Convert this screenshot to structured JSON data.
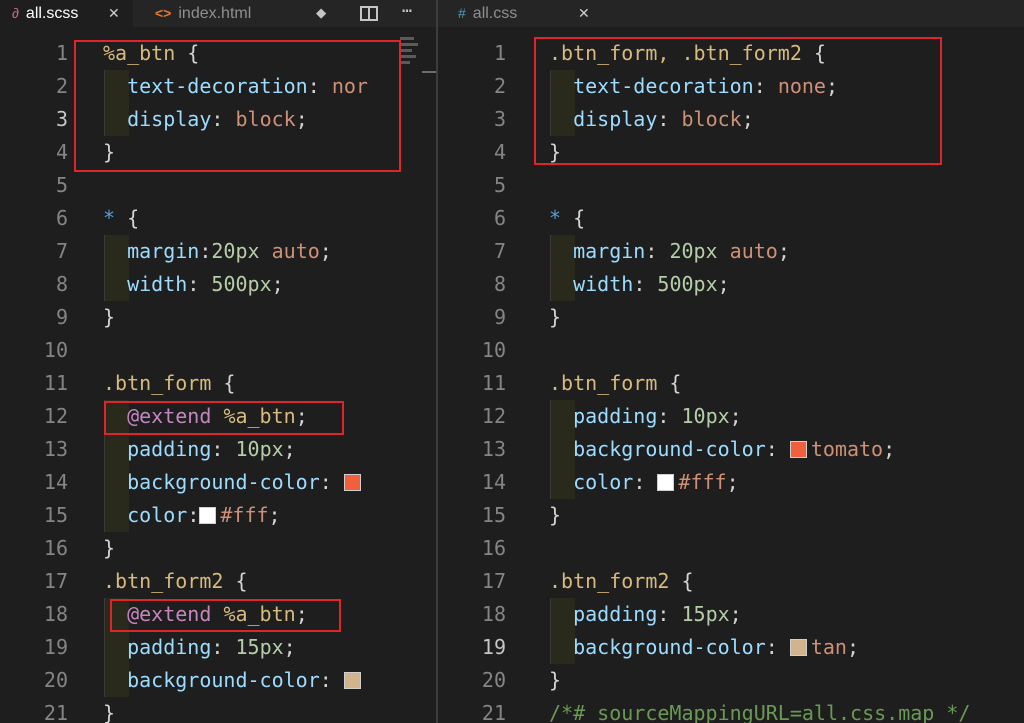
{
  "left": {
    "tabs": [
      {
        "name": "all.scss",
        "icon": "sass-file-icon",
        "active": true
      },
      {
        "name": "index.html",
        "icon": "html-file-icon",
        "active": false
      }
    ],
    "toolbar": {
      "git_icon": "git-compare-icon",
      "split_icon": "split-editor-icon",
      "more_icon": "more-actions-icon"
    },
    "lines": [
      {
        "n": "1",
        "tokens": [
          [
            "%a_btn",
            "sel"
          ],
          [
            " {",
            "p"
          ]
        ]
      },
      {
        "n": "2",
        "tokens": [
          [
            "  ",
            "p"
          ],
          [
            "text-decoration",
            "prop"
          ],
          [
            ": ",
            "p"
          ],
          [
            "nor",
            "val"
          ]
        ]
      },
      {
        "n": "3",
        "tokens": [
          [
            "  ",
            "p"
          ],
          [
            "display",
            "prop"
          ],
          [
            ": ",
            "p"
          ],
          [
            "block",
            "val"
          ],
          [
            ";",
            "p"
          ]
        ]
      },
      {
        "n": "4",
        "tokens": [
          [
            "}",
            "p"
          ]
        ]
      },
      {
        "n": "5",
        "tokens": []
      },
      {
        "n": "6",
        "tokens": [
          [
            "*",
            "star"
          ],
          [
            " {",
            "p"
          ]
        ]
      },
      {
        "n": "7",
        "tokens": [
          [
            "  ",
            "p"
          ],
          [
            "margin",
            "prop"
          ],
          [
            ":",
            "p"
          ],
          [
            "20px",
            "num"
          ],
          [
            " ",
            "p"
          ],
          [
            "auto",
            "val"
          ],
          [
            ";",
            "p"
          ]
        ]
      },
      {
        "n": "8",
        "tokens": [
          [
            "  ",
            "p"
          ],
          [
            "width",
            "prop"
          ],
          [
            ": ",
            "p"
          ],
          [
            "500px",
            "num"
          ],
          [
            ";",
            "p"
          ]
        ]
      },
      {
        "n": "9",
        "tokens": [
          [
            "}",
            "p"
          ]
        ]
      },
      {
        "n": "10",
        "tokens": []
      },
      {
        "n": "11",
        "tokens": [
          [
            ".btn_form",
            "sel"
          ],
          [
            " {",
            "p"
          ]
        ]
      },
      {
        "n": "12",
        "tokens": [
          [
            "  ",
            "p"
          ],
          [
            "@extend",
            "kw"
          ],
          [
            " ",
            "p"
          ],
          [
            "%a_btn",
            "sel"
          ],
          [
            ";",
            "p"
          ]
        ]
      },
      {
        "n": "13",
        "tokens": [
          [
            "  ",
            "p"
          ],
          [
            "padding",
            "prop"
          ],
          [
            ": ",
            "p"
          ],
          [
            "10px",
            "num"
          ],
          [
            ";",
            "p"
          ]
        ]
      },
      {
        "n": "14",
        "tokens": [
          [
            "  ",
            "p"
          ],
          [
            "background-color",
            "prop"
          ],
          [
            ": ",
            "p"
          ],
          [
            "swatch:#f0603c",
            "sw"
          ]
        ]
      },
      {
        "n": "15",
        "tokens": [
          [
            "  ",
            "p"
          ],
          [
            "color",
            "prop"
          ],
          [
            ":",
            "p"
          ],
          [
            "swatch:#ffffff",
            "sw"
          ],
          [
            "#fff",
            "val"
          ],
          [
            ";",
            "p"
          ]
        ]
      },
      {
        "n": "16",
        "tokens": [
          [
            "}",
            "p"
          ]
        ]
      },
      {
        "n": "17",
        "tokens": [
          [
            ".btn_form2",
            "sel"
          ],
          [
            " {",
            "p"
          ]
        ]
      },
      {
        "n": "18",
        "tokens": [
          [
            "  ",
            "p"
          ],
          [
            "@extend",
            "kw"
          ],
          [
            " ",
            "p"
          ],
          [
            "%a_btn",
            "sel"
          ],
          [
            ";",
            "p"
          ]
        ]
      },
      {
        "n": "19",
        "tokens": [
          [
            "  ",
            "p"
          ],
          [
            "padding",
            "prop"
          ],
          [
            ": ",
            "p"
          ],
          [
            "15px",
            "num"
          ],
          [
            ";",
            "p"
          ]
        ]
      },
      {
        "n": "20",
        "tokens": [
          [
            "  ",
            "p"
          ],
          [
            "background-color",
            "prop"
          ],
          [
            ": ",
            "p"
          ],
          [
            "swatch:#d2b48c",
            "sw"
          ]
        ]
      },
      {
        "n": "21",
        "tokens": [
          [
            "}",
            "p"
          ]
        ]
      }
    ],
    "current_line": "3"
  },
  "right": {
    "tabs": [
      {
        "name": "all.css",
        "icon": "css-file-icon",
        "active": false
      }
    ],
    "lines": [
      {
        "n": "1",
        "tokens": [
          [
            ".btn_form, .btn_form2",
            "sel"
          ],
          [
            " {",
            "p"
          ]
        ]
      },
      {
        "n": "2",
        "tokens": [
          [
            "  ",
            "p"
          ],
          [
            "text-decoration",
            "prop"
          ],
          [
            ": ",
            "p"
          ],
          [
            "none",
            "val"
          ],
          [
            ";",
            "p"
          ]
        ]
      },
      {
        "n": "3",
        "tokens": [
          [
            "  ",
            "p"
          ],
          [
            "display",
            "prop"
          ],
          [
            ": ",
            "p"
          ],
          [
            "block",
            "val"
          ],
          [
            ";",
            "p"
          ]
        ]
      },
      {
        "n": "4",
        "tokens": [
          [
            "}",
            "p"
          ]
        ]
      },
      {
        "n": "5",
        "tokens": []
      },
      {
        "n": "6",
        "tokens": [
          [
            "*",
            "star"
          ],
          [
            " {",
            "p"
          ]
        ]
      },
      {
        "n": "7",
        "tokens": [
          [
            "  ",
            "p"
          ],
          [
            "margin",
            "prop"
          ],
          [
            ": ",
            "p"
          ],
          [
            "20px",
            "num"
          ],
          [
            " ",
            "p"
          ],
          [
            "auto",
            "val"
          ],
          [
            ";",
            "p"
          ]
        ]
      },
      {
        "n": "8",
        "tokens": [
          [
            "  ",
            "p"
          ],
          [
            "width",
            "prop"
          ],
          [
            ": ",
            "p"
          ],
          [
            "500px",
            "num"
          ],
          [
            ";",
            "p"
          ]
        ]
      },
      {
        "n": "9",
        "tokens": [
          [
            "}",
            "p"
          ]
        ]
      },
      {
        "n": "10",
        "tokens": []
      },
      {
        "n": "11",
        "tokens": [
          [
            ".btn_form",
            "sel"
          ],
          [
            " {",
            "p"
          ]
        ]
      },
      {
        "n": "12",
        "tokens": [
          [
            "  ",
            "p"
          ],
          [
            "padding",
            "prop"
          ],
          [
            ": ",
            "p"
          ],
          [
            "10px",
            "num"
          ],
          [
            ";",
            "p"
          ]
        ]
      },
      {
        "n": "13",
        "tokens": [
          [
            "  ",
            "p"
          ],
          [
            "background-color",
            "prop"
          ],
          [
            ": ",
            "p"
          ],
          [
            "swatch:#f0603c",
            "sw"
          ],
          [
            "tomato",
            "val"
          ],
          [
            ";",
            "p"
          ]
        ]
      },
      {
        "n": "14",
        "tokens": [
          [
            "  ",
            "p"
          ],
          [
            "color",
            "prop"
          ],
          [
            ": ",
            "p"
          ],
          [
            "swatch:#ffffff",
            "sw"
          ],
          [
            "#fff",
            "val"
          ],
          [
            ";",
            "p"
          ]
        ]
      },
      {
        "n": "15",
        "tokens": [
          [
            "}",
            "p"
          ]
        ]
      },
      {
        "n": "16",
        "tokens": []
      },
      {
        "n": "17",
        "tokens": [
          [
            ".btn_form2",
            "sel"
          ],
          [
            " {",
            "p"
          ]
        ]
      },
      {
        "n": "18",
        "tokens": [
          [
            "  ",
            "p"
          ],
          [
            "padding",
            "prop"
          ],
          [
            ": ",
            "p"
          ],
          [
            "15px",
            "num"
          ],
          [
            ";",
            "p"
          ]
        ]
      },
      {
        "n": "19",
        "tokens": [
          [
            "  ",
            "p"
          ],
          [
            "background-color",
            "prop"
          ],
          [
            ": ",
            "p"
          ],
          [
            "swatch:#d2b48c",
            "sw"
          ],
          [
            "tan",
            "val"
          ],
          [
            ";",
            "p"
          ]
        ]
      },
      {
        "n": "20",
        "tokens": [
          [
            "}",
            "p"
          ]
        ]
      },
      {
        "n": "21",
        "tokens": [
          [
            "/*# sourceMappingURL=all.css.map */",
            "com"
          ]
        ]
      }
    ],
    "current_line": "19"
  },
  "colors": {
    "highlight_box": "#e0242b",
    "editor_bg": "#1e1e1e",
    "tab_bar_bg": "#252526"
  }
}
